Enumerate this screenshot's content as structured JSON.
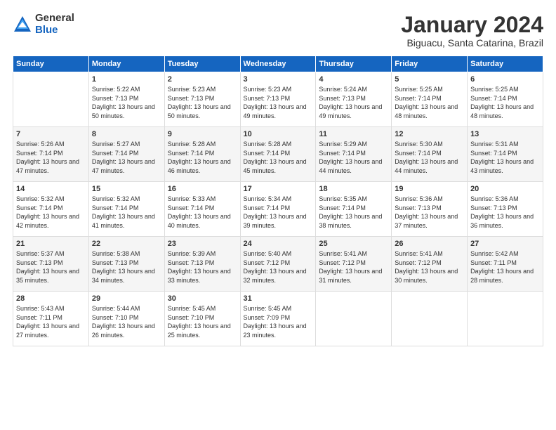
{
  "logo": {
    "general": "General",
    "blue": "Blue"
  },
  "title": "January 2024",
  "subtitle": "Biguacu, Santa Catarina, Brazil",
  "headers": [
    "Sunday",
    "Monday",
    "Tuesday",
    "Wednesday",
    "Thursday",
    "Friday",
    "Saturday"
  ],
  "weeks": [
    [
      {
        "day": "",
        "info": ""
      },
      {
        "day": "1",
        "info": "Sunrise: 5:22 AM\nSunset: 7:13 PM\nDaylight: 13 hours\nand 50 minutes."
      },
      {
        "day": "2",
        "info": "Sunrise: 5:23 AM\nSunset: 7:13 PM\nDaylight: 13 hours\nand 50 minutes."
      },
      {
        "day": "3",
        "info": "Sunrise: 5:23 AM\nSunset: 7:13 PM\nDaylight: 13 hours\nand 49 minutes."
      },
      {
        "day": "4",
        "info": "Sunrise: 5:24 AM\nSunset: 7:13 PM\nDaylight: 13 hours\nand 49 minutes."
      },
      {
        "day": "5",
        "info": "Sunrise: 5:25 AM\nSunset: 7:14 PM\nDaylight: 13 hours\nand 48 minutes."
      },
      {
        "day": "6",
        "info": "Sunrise: 5:25 AM\nSunset: 7:14 PM\nDaylight: 13 hours\nand 48 minutes."
      }
    ],
    [
      {
        "day": "7",
        "info": "Sunrise: 5:26 AM\nSunset: 7:14 PM\nDaylight: 13 hours\nand 47 minutes."
      },
      {
        "day": "8",
        "info": "Sunrise: 5:27 AM\nSunset: 7:14 PM\nDaylight: 13 hours\nand 47 minutes."
      },
      {
        "day": "9",
        "info": "Sunrise: 5:28 AM\nSunset: 7:14 PM\nDaylight: 13 hours\nand 46 minutes."
      },
      {
        "day": "10",
        "info": "Sunrise: 5:28 AM\nSunset: 7:14 PM\nDaylight: 13 hours\nand 45 minutes."
      },
      {
        "day": "11",
        "info": "Sunrise: 5:29 AM\nSunset: 7:14 PM\nDaylight: 13 hours\nand 44 minutes."
      },
      {
        "day": "12",
        "info": "Sunrise: 5:30 AM\nSunset: 7:14 PM\nDaylight: 13 hours\nand 44 minutes."
      },
      {
        "day": "13",
        "info": "Sunrise: 5:31 AM\nSunset: 7:14 PM\nDaylight: 13 hours\nand 43 minutes."
      }
    ],
    [
      {
        "day": "14",
        "info": "Sunrise: 5:32 AM\nSunset: 7:14 PM\nDaylight: 13 hours\nand 42 minutes."
      },
      {
        "day": "15",
        "info": "Sunrise: 5:32 AM\nSunset: 7:14 PM\nDaylight: 13 hours\nand 41 minutes."
      },
      {
        "day": "16",
        "info": "Sunrise: 5:33 AM\nSunset: 7:14 PM\nDaylight: 13 hours\nand 40 minutes."
      },
      {
        "day": "17",
        "info": "Sunrise: 5:34 AM\nSunset: 7:14 PM\nDaylight: 13 hours\nand 39 minutes."
      },
      {
        "day": "18",
        "info": "Sunrise: 5:35 AM\nSunset: 7:14 PM\nDaylight: 13 hours\nand 38 minutes."
      },
      {
        "day": "19",
        "info": "Sunrise: 5:36 AM\nSunset: 7:13 PM\nDaylight: 13 hours\nand 37 minutes."
      },
      {
        "day": "20",
        "info": "Sunrise: 5:36 AM\nSunset: 7:13 PM\nDaylight: 13 hours\nand 36 minutes."
      }
    ],
    [
      {
        "day": "21",
        "info": "Sunrise: 5:37 AM\nSunset: 7:13 PM\nDaylight: 13 hours\nand 35 minutes."
      },
      {
        "day": "22",
        "info": "Sunrise: 5:38 AM\nSunset: 7:13 PM\nDaylight: 13 hours\nand 34 minutes."
      },
      {
        "day": "23",
        "info": "Sunrise: 5:39 AM\nSunset: 7:13 PM\nDaylight: 13 hours\nand 33 minutes."
      },
      {
        "day": "24",
        "info": "Sunrise: 5:40 AM\nSunset: 7:12 PM\nDaylight: 13 hours\nand 32 minutes."
      },
      {
        "day": "25",
        "info": "Sunrise: 5:41 AM\nSunset: 7:12 PM\nDaylight: 13 hours\nand 31 minutes."
      },
      {
        "day": "26",
        "info": "Sunrise: 5:41 AM\nSunset: 7:12 PM\nDaylight: 13 hours\nand 30 minutes."
      },
      {
        "day": "27",
        "info": "Sunrise: 5:42 AM\nSunset: 7:11 PM\nDaylight: 13 hours\nand 28 minutes."
      }
    ],
    [
      {
        "day": "28",
        "info": "Sunrise: 5:43 AM\nSunset: 7:11 PM\nDaylight: 13 hours\nand 27 minutes."
      },
      {
        "day": "29",
        "info": "Sunrise: 5:44 AM\nSunset: 7:10 PM\nDaylight: 13 hours\nand 26 minutes."
      },
      {
        "day": "30",
        "info": "Sunrise: 5:45 AM\nSunset: 7:10 PM\nDaylight: 13 hours\nand 25 minutes."
      },
      {
        "day": "31",
        "info": "Sunrise: 5:45 AM\nSunset: 7:09 PM\nDaylight: 13 hours\nand 23 minutes."
      },
      {
        "day": "",
        "info": ""
      },
      {
        "day": "",
        "info": ""
      },
      {
        "day": "",
        "info": ""
      }
    ]
  ]
}
